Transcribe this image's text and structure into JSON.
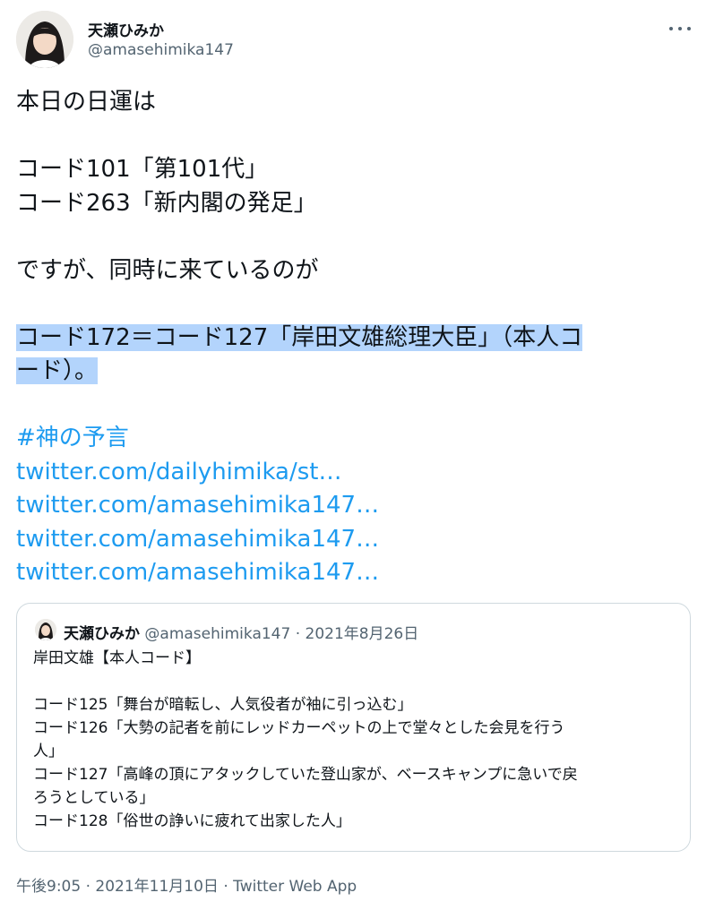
{
  "author": {
    "name": "天瀬ひみか",
    "handle": "@amasehimika147"
  },
  "tweet": {
    "lines": {
      "l1": "本日の日運は",
      "l2": "コード101「第101代」",
      "l3": "コード263「新内閣の発足」",
      "l4": "ですが、同時に来ているのが",
      "l5": "コード172＝コード127「岸田文雄総理大臣」（本人コ",
      "l6": "ード）。"
    },
    "hashtag": "#神の予言",
    "links": [
      "twitter.com/dailyhimika/st…",
      "twitter.com/amasehimika147…",
      "twitter.com/amasehimika147…",
      "twitter.com/amasehimika147…"
    ]
  },
  "quote": {
    "name": "天瀬ひみか",
    "handle_date": "@amasehimika147 · 2021年8月26日",
    "lines": {
      "l1": "岸田文雄【本人コード】",
      "l2": "コード125「舞台が暗転し、人気役者が袖に引っ込む」",
      "l3": "コード126「大勢の記者を前にレッドカーペットの上で堂々とした会見を行う",
      "l4": "人」",
      "l5": "コード127「高峰の頂にアタックしていた登山家が、ベースキャンプに急いで戻",
      "l6": "ろうとしている」",
      "l7": "コード128「俗世の諍いに疲れて出家した人」"
    }
  },
  "footer": {
    "time_date": "午後9:05 · 2021年11月10日 · ",
    "source": "Twitter Web App"
  },
  "colors": {
    "link": "#1d9bf0",
    "highlight": "#b3d4fc",
    "secondary": "#536471"
  },
  "icons": {
    "more": "more-horizontal-icon"
  }
}
